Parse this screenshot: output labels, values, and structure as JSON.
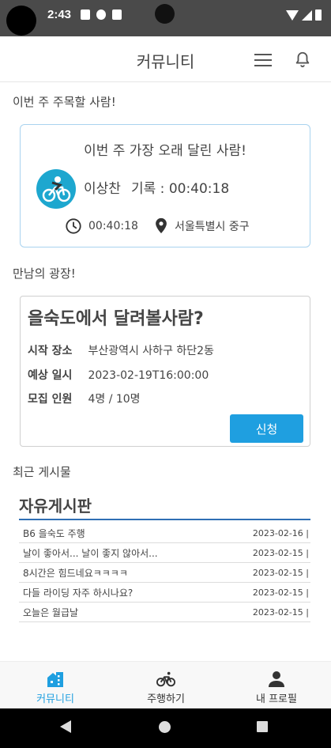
{
  "status_bar": {
    "time": "2:43"
  },
  "header": {
    "title": "커뮤니티"
  },
  "weekly": {
    "section_label": "이번 주 주목할 사람!",
    "card_title": "이번 주 가장 오래 달린 사람!",
    "runner_name": "이상찬",
    "record_text": "기록 : 00:40:18",
    "duration": "00:40:18",
    "location": "서울특별시 중구"
  },
  "plaza": {
    "section_label": "만남의 광장!",
    "title": "을숙도에서 달려볼사람?",
    "rows": [
      {
        "key": "시작 장소",
        "value": "부산광역시 사하구 하단2동"
      },
      {
        "key": "예상 일시",
        "value": "2023-02-19T16:00:00"
      },
      {
        "key": "모집 인원",
        "value": "4명 / 10명"
      }
    ],
    "apply_label": "신청"
  },
  "recent": {
    "section_label": "최근 게시물",
    "board_title": "자유게시판",
    "posts": [
      {
        "title": "B6 을숙도 주행",
        "date": "2023-02-16 |"
      },
      {
        "title": "날이 좋아서... 날이 좋지 않아서...",
        "date": "2023-02-15 |"
      },
      {
        "title": "8시간은 힘드네요ㅋㅋㅋㅋ",
        "date": "2023-02-15 |"
      },
      {
        "title": "다들 라이딩 자주 하시나요?",
        "date": "2023-02-15 |"
      },
      {
        "title": "오늘은 월급날",
        "date": "2023-02-15 |"
      }
    ]
  },
  "bottom_nav": {
    "items": [
      {
        "label": "커뮤니티",
        "icon": "community-icon",
        "active": true
      },
      {
        "label": "주행하기",
        "icon": "bicycle-icon",
        "active": false
      },
      {
        "label": "내 프로필",
        "icon": "person-icon",
        "active": false
      }
    ]
  },
  "colors": {
    "accent": "#1f9fe0",
    "card_border": "#a9d3ef",
    "board_line": "#2f6fb4",
    "status_bar": "#4a4a4a"
  }
}
